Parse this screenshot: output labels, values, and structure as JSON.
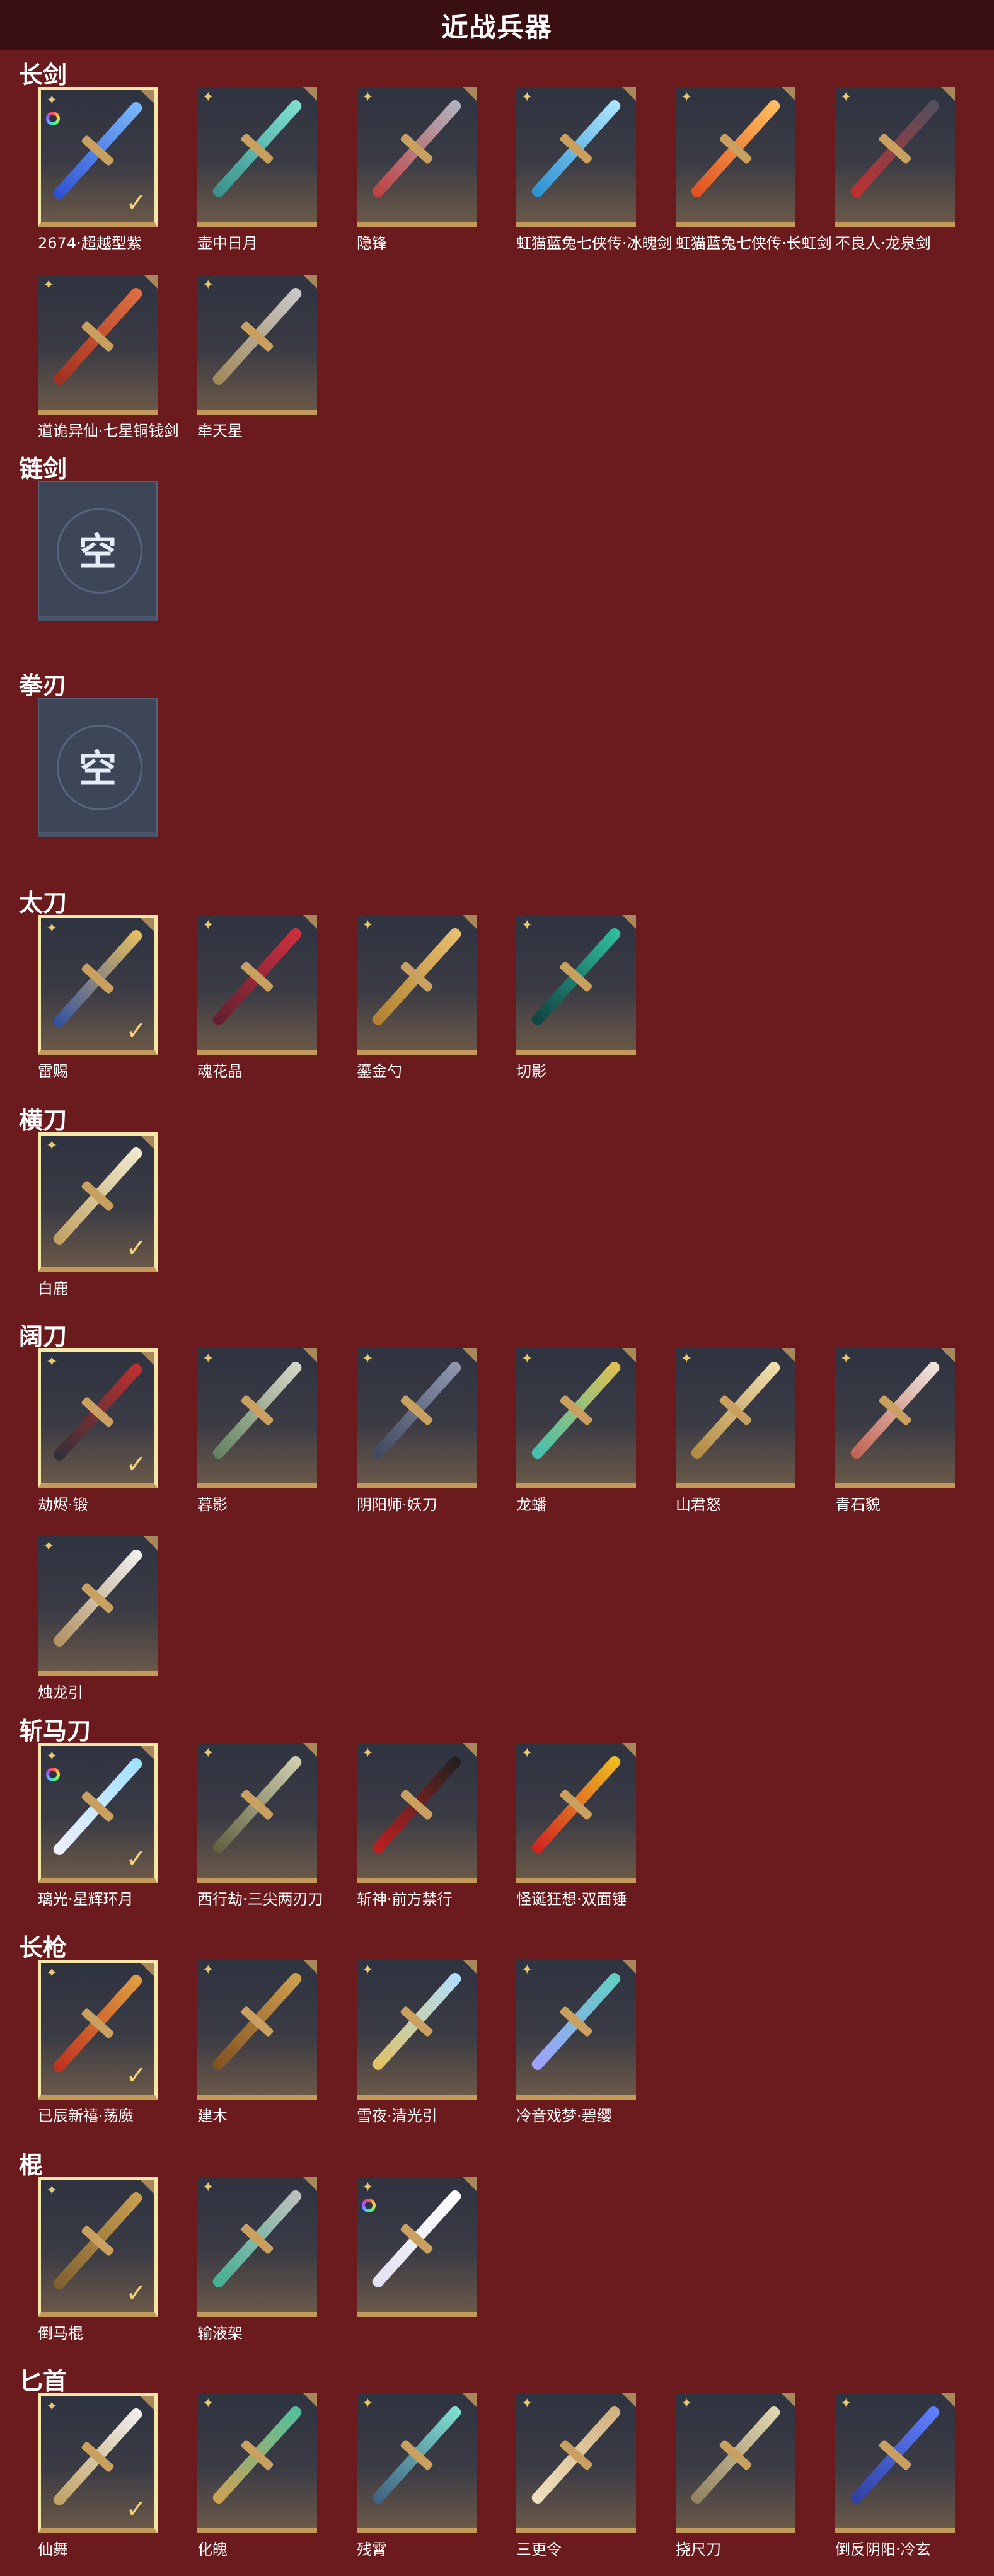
{
  "page": {
    "title": "近战兵器"
  },
  "icons": {
    "star": "✦",
    "check": "✓",
    "empty": "空"
  },
  "sections": [
    {
      "title": "长剑",
      "items": [
        {
          "label": "2674·超越型紫",
          "selected": true,
          "ring": true,
          "colors": [
            "#7ab8ff",
            "#3050d0"
          ]
        },
        {
          "label": "壶中日月",
          "selected": false,
          "ring": false,
          "colors": [
            "#7de0d0",
            "#3a8f8a"
          ]
        },
        {
          "label": "隐锋",
          "selected": false,
          "ring": false,
          "colors": [
            "#b0b4c0",
            "#c04040"
          ]
        },
        {
          "label": "虹猫蓝兔七侠传·冰魄剑",
          "selected": false,
          "ring": false,
          "colors": [
            "#aee6ff",
            "#2a90d0"
          ]
        },
        {
          "label": "虹猫蓝兔七侠传·长虹剑",
          "selected": false,
          "ring": false,
          "colors": [
            "#ffc060",
            "#e05020"
          ]
        },
        {
          "label": "不良人·龙泉剑",
          "selected": false,
          "ring": false,
          "colors": [
            "#505060",
            "#c03030"
          ]
        },
        {
          "label": "道诡异仙·七星铜钱剑",
          "selected": false,
          "ring": false,
          "colors": [
            "#e07040",
            "#a03020"
          ]
        },
        {
          "label": "牵天星",
          "selected": false,
          "ring": false,
          "colors": [
            "#c8c8c8",
            "#a08858"
          ]
        }
      ]
    },
    {
      "title": "链剑",
      "items": [
        {
          "label": "",
          "empty": true
        }
      ]
    },
    {
      "title": "拳刃",
      "items": [
        {
          "label": "",
          "empty": true
        }
      ]
    },
    {
      "title": "太刀",
      "items": [
        {
          "label": "雷赐",
          "selected": true,
          "ring": false,
          "colors": [
            "#e8c060",
            "#3050a0"
          ]
        },
        {
          "label": "魂花晶",
          "selected": false,
          "ring": false,
          "colors": [
            "#d03040",
            "#602030"
          ]
        },
        {
          "label": "鎏金勺",
          "selected": false,
          "ring": false,
          "colors": [
            "#e8c070",
            "#b08030"
          ]
        },
        {
          "label": "切影",
          "selected": false,
          "ring": false,
          "colors": [
            "#30c0a0",
            "#104040"
          ]
        }
      ]
    },
    {
      "title": "横刀",
      "items": [
        {
          "label": "白鹿",
          "selected": true,
          "ring": false,
          "colors": [
            "#f0ead0",
            "#c0a060"
          ]
        }
      ]
    },
    {
      "title": "阔刀",
      "items": [
        {
          "label": "劫烬·锻",
          "selected": true,
          "ring": false,
          "colors": [
            "#c03030",
            "#303038"
          ]
        },
        {
          "label": "暮影",
          "selected": false,
          "ring": false,
          "colors": [
            "#d8d8c8",
            "#608060"
          ]
        },
        {
          "label": "阴阳师·妖刀",
          "selected": false,
          "ring": false,
          "colors": [
            "#9098b0",
            "#404860"
          ]
        },
        {
          "label": "龙蟠",
          "selected": false,
          "ring": false,
          "colors": [
            "#e0c050",
            "#40c0b0"
          ]
        },
        {
          "label": "山君怒",
          "selected": false,
          "ring": false,
          "colors": [
            "#f0e0b0",
            "#b08840"
          ]
        },
        {
          "label": "青石貌",
          "selected": false,
          "ring": false,
          "colors": [
            "#f0e8e0",
            "#c06050"
          ]
        },
        {
          "label": "烛龙引",
          "selected": false,
          "ring": false,
          "colors": [
            "#f0f0f0",
            "#b09060"
          ]
        }
      ]
    },
    {
      "title": "斩马刀",
      "items": [
        {
          "label": "璃光·星辉环月",
          "selected": true,
          "ring": true,
          "colors": [
            "#a0e0ff",
            "#f0f0ff"
          ]
        },
        {
          "label": "西行劫·三尖两刃刀",
          "selected": false,
          "ring": false,
          "colors": [
            "#d0d0b0",
            "#606040"
          ]
        },
        {
          "label": "斩神·前方禁行",
          "selected": false,
          "ring": false,
          "colors": [
            "#202020",
            "#c02020"
          ]
        },
        {
          "label": "怪诞狂想·双面锤",
          "selected": false,
          "ring": false,
          "colors": [
            "#f0c020",
            "#d02020"
          ]
        }
      ]
    },
    {
      "title": "长枪",
      "items": [
        {
          "label": "已辰新禧·荡魔",
          "selected": true,
          "ring": false,
          "colors": [
            "#e0a040",
            "#c03020"
          ]
        },
        {
          "label": "建木",
          "selected": false,
          "ring": false,
          "colors": [
            "#d0a050",
            "#805020"
          ]
        },
        {
          "label": "雪夜·清光引",
          "selected": false,
          "ring": false,
          "colors": [
            "#b0e0ff",
            "#e0c060"
          ]
        },
        {
          "label": "冷音戏梦·碧缨",
          "selected": false,
          "ring": false,
          "colors": [
            "#60d0c0",
            "#a0a0ff"
          ]
        }
      ]
    },
    {
      "title": "棍",
      "items": [
        {
          "label": "倒马棍",
          "selected": true,
          "ring": false,
          "colors": [
            "#c8a050",
            "#806030"
          ]
        },
        {
          "label": "输液架",
          "selected": false,
          "ring": false,
          "colors": [
            "#c0c0c0",
            "#40b090"
          ]
        },
        {
          "label": "",
          "selected": false,
          "ring": true,
          "colors": [
            "#ffffff",
            "#e0e0f0"
          ]
        }
      ]
    },
    {
      "title": "匕首",
      "items": [
        {
          "label": "仙舞",
          "selected": true,
          "ring": false,
          "colors": [
            "#f0f0f0",
            "#c0a060"
          ]
        },
        {
          "label": "化魄",
          "selected": false,
          "ring": false,
          "colors": [
            "#50c0a0",
            "#d0a050"
          ]
        },
        {
          "label": "残霄",
          "selected": false,
          "ring": false,
          "colors": [
            "#80e0d0",
            "#406080"
          ]
        },
        {
          "label": "三更令",
          "selected": false,
          "ring": false,
          "colors": [
            "#d0b080",
            "#f0e0c0"
          ]
        },
        {
          "label": "挠尺刀",
          "selected": false,
          "ring": false,
          "colors": [
            "#e0d8b0",
            "#908060"
          ]
        },
        {
          "label": "倒反阴阳·冷玄",
          "selected": false,
          "ring": false,
          "colors": [
            "#6080ff",
            "#3040a0"
          ]
        }
      ]
    }
  ]
}
